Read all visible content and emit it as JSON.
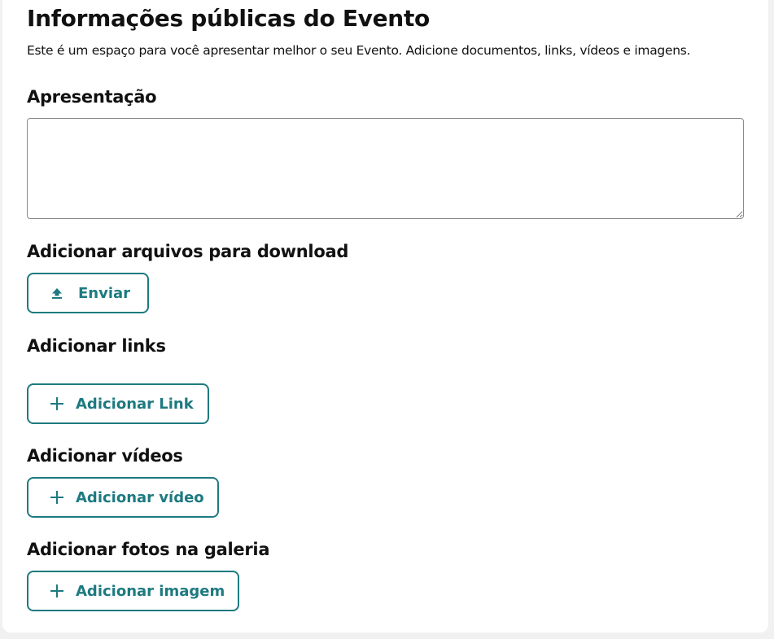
{
  "page": {
    "title": "Informações públicas do Evento",
    "description": "Este é um espaço para você apresentar melhor o seu Evento. Adicione documentos, links, vídeos e imagens."
  },
  "presentation": {
    "label": "Apresentação",
    "value": ""
  },
  "downloads": {
    "label": "Adicionar arquivos para download",
    "button_label": "Enviar",
    "button_icon": "upload-icon"
  },
  "links": {
    "label": "Adicionar links",
    "button_label": "Adicionar Link",
    "button_icon": "plus-icon"
  },
  "videos": {
    "label": "Adicionar vídeos",
    "button_label": "Adicionar vídeo",
    "button_icon": "plus-icon"
  },
  "gallery": {
    "label": "Adicionar fotos na galeria",
    "button_label": "Adicionar imagem",
    "button_icon": "plus-icon"
  },
  "colors": {
    "accent": "#1d7a80",
    "text": "#111111",
    "background": "#f1f1f1",
    "card": "#ffffff"
  }
}
